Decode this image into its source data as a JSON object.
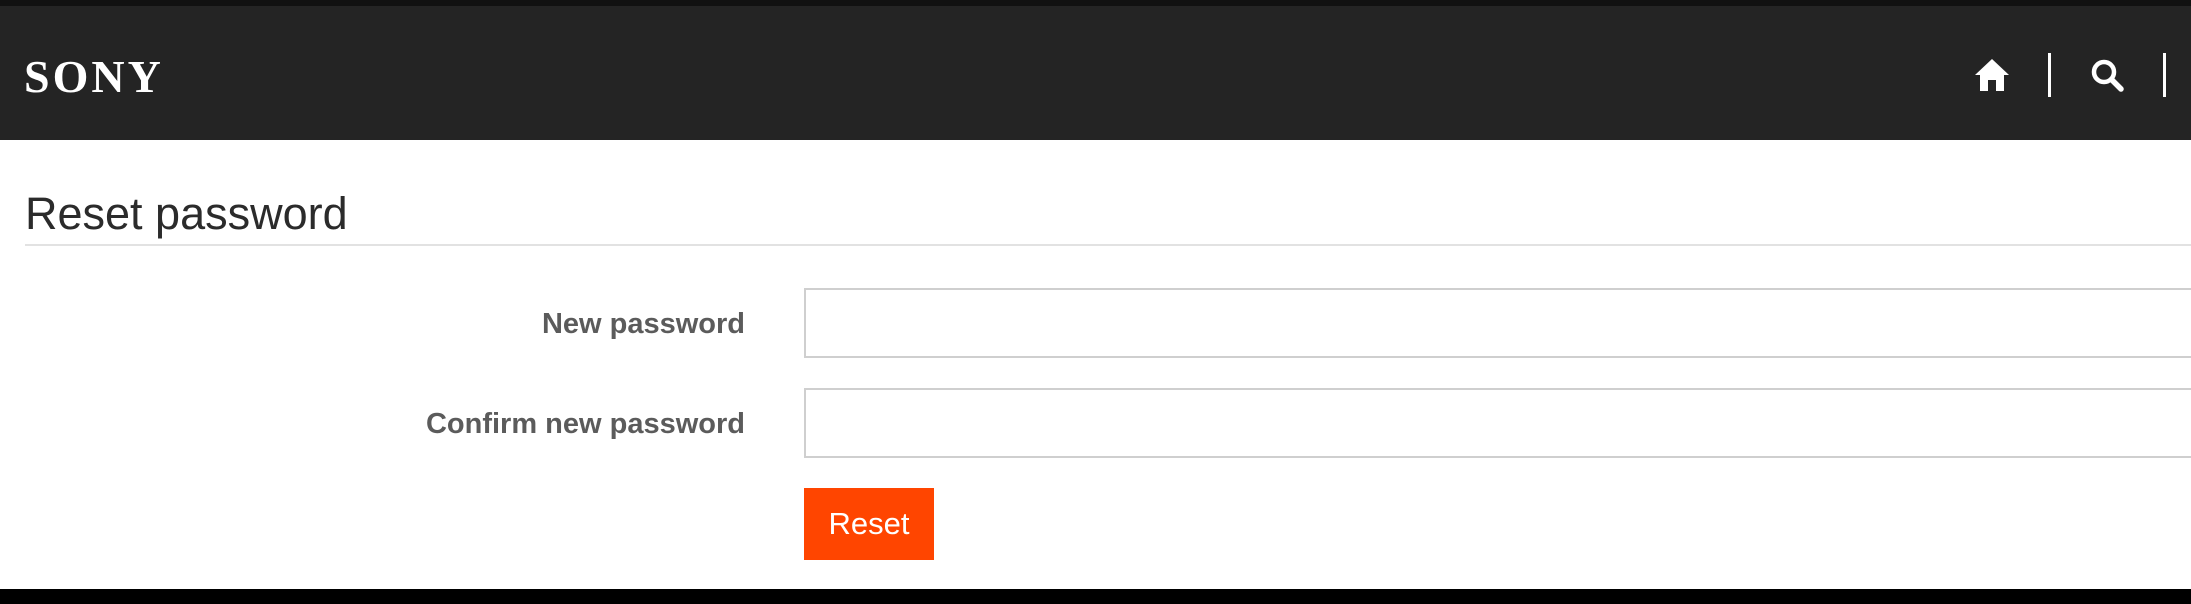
{
  "header": {
    "logo_text": "SONY",
    "nav_icons": [
      "home-icon",
      "search-icon"
    ]
  },
  "page": {
    "title": "Reset password"
  },
  "form": {
    "new_password_label": "New password",
    "new_password_value": "",
    "confirm_password_label": "Confirm new password",
    "confirm_password_value": "",
    "reset_label": "Reset"
  },
  "colors": {
    "header_bg": "#242424",
    "accent": "#ff4500",
    "label_text": "#5b5b5b",
    "title_text": "#2b2b2b",
    "input_border": "#cfcfcf"
  }
}
